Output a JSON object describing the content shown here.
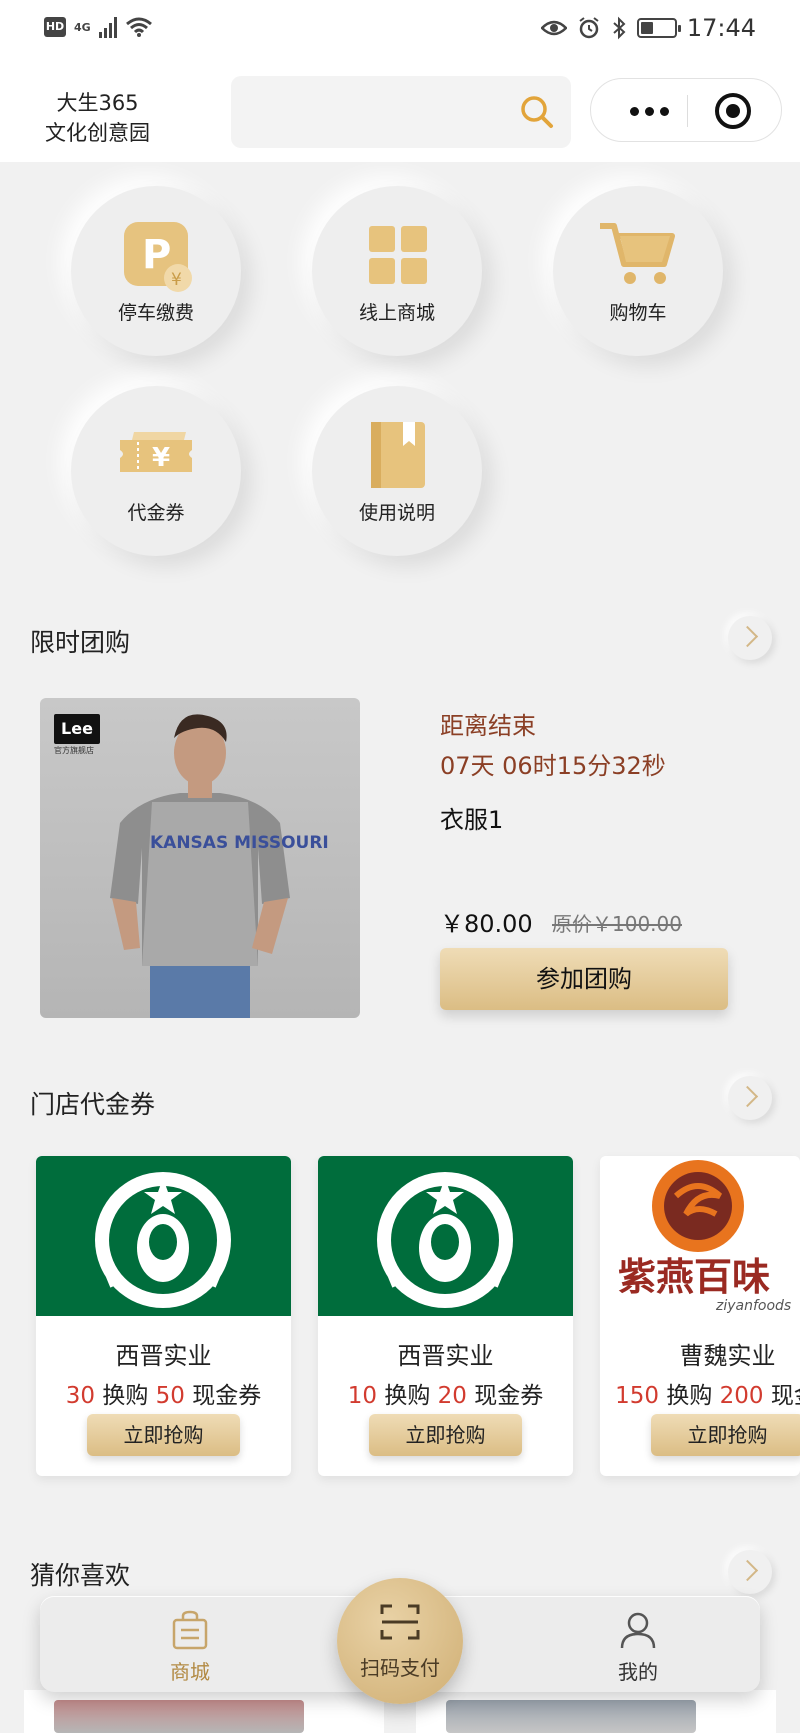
{
  "status_bar": {
    "hd": "HD",
    "network": "4G",
    "battery_level": 0.35,
    "time": "17:44"
  },
  "header": {
    "brand_line1": "大生365",
    "brand_line2": "文化创意园",
    "search_placeholder": ""
  },
  "quick_nav": [
    {
      "label": "停车缴费",
      "icon": "parking-icon"
    },
    {
      "label": "线上商城",
      "icon": "grid-icon"
    },
    {
      "label": "购物车",
      "icon": "cart-icon"
    },
    {
      "label": "代金券",
      "icon": "ticket-icon"
    },
    {
      "label": "使用说明",
      "icon": "book-icon"
    }
  ],
  "group_buy": {
    "title": "限时团购",
    "brand_logo": "Lee",
    "brand_sub": "官方旗舰店",
    "shirt_text": "KANSAS MISSOURI",
    "ends_label": "距离结束",
    "countdown": "07天 06时15分32秒",
    "product_name": "衣服1",
    "price": "￥80.00",
    "original_price": "原价￥100.00",
    "button": "参加团购"
  },
  "vouchers": {
    "title": "门店代金券",
    "items": [
      {
        "store": "西晋实业",
        "pay": "30",
        "mid": " 换购 ",
        "get": "50",
        "suffix": " 现金券",
        "button": "立即抢购",
        "logo": "starbucks"
      },
      {
        "store": "西晋实业",
        "pay": "10",
        "mid": " 换购 ",
        "get": "20",
        "suffix": " 现金券",
        "button": "立即抢购",
        "logo": "starbucks"
      },
      {
        "store": "曹魏实业",
        "pay": "150",
        "mid": " 换购 ",
        "get": "200",
        "suffix": " 现金券",
        "button": "立即抢购",
        "logo": "ziyan",
        "logo_text": "紫燕百味",
        "logo_sub": "ziyanfoods"
      }
    ]
  },
  "recommend": {
    "title": "猜你喜欢"
  },
  "tabbar": {
    "mall": "商城",
    "scan": "扫码支付",
    "mine": "我的"
  },
  "colors": {
    "gold": "#d9b97c",
    "countdown": "#8b3f25",
    "price_red": "#d23b2f",
    "starbucks_green": "#006d3c"
  }
}
